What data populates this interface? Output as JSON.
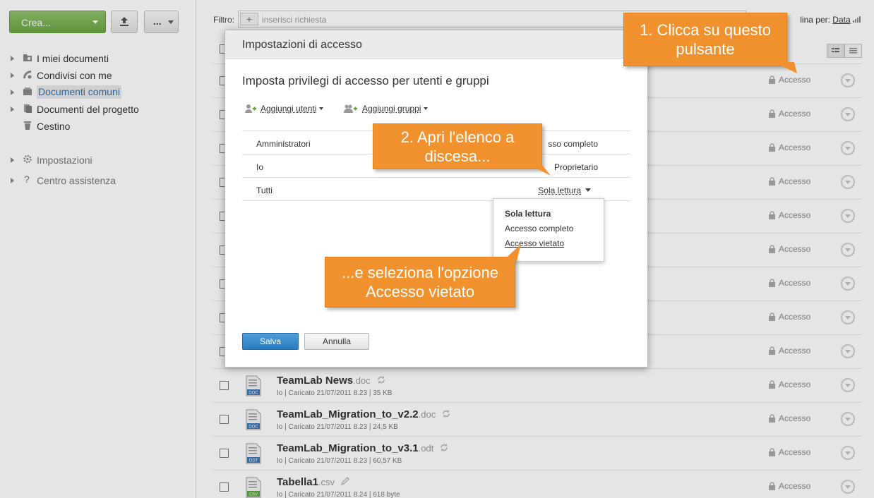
{
  "toolbar": {
    "create_label": "Crea...",
    "more_label": "..."
  },
  "sidebar": {
    "items": [
      {
        "label": "I miei documenti",
        "icon": "folder-user-icon"
      },
      {
        "label": "Condivisi con me",
        "icon": "shared-icon"
      },
      {
        "label": "Documenti comuni",
        "icon": "common-docs-icon"
      },
      {
        "label": "Documenti del progetto",
        "icon": "project-docs-icon"
      },
      {
        "label": "Cestino",
        "icon": "trash-icon"
      }
    ],
    "secondary": [
      {
        "label": "Impostazioni",
        "icon": "gear-icon"
      },
      {
        "label": "Centro assistenza",
        "icon": "help-icon"
      }
    ]
  },
  "filter": {
    "label": "Filtro:",
    "placeholder": "inserisci richiesta",
    "sort_prefix": "lina per:",
    "sort_value": "Data"
  },
  "file_rows": {
    "access_label": "Accesso",
    "files": [
      {
        "name": "TeamLab News",
        "ext": ".doc",
        "meta": "Io | Caricato 21/07/2011 8.23 | 35 KB",
        "type": "DOC"
      },
      {
        "name": "TeamLab_Migration_to_v2.2",
        "ext": ".doc",
        "meta": "Io | Caricato 21/07/2011 8.23 | 24,5 KB",
        "type": "DOC"
      },
      {
        "name": "TeamLab_Migration_to_v3.1",
        "ext": ".odt",
        "meta": "Io | Caricato 21/07/2011 8.23 | 60,57 KB",
        "type": "ODT"
      },
      {
        "name": "Tabella1",
        "ext": ".csv",
        "meta": "Io | Caricato 21/07/2011 8.24 | 618 byte",
        "type": "CSV"
      }
    ]
  },
  "dialog": {
    "title": "Impostazioni di accesso",
    "subtitle": "Imposta privilegi di accesso per utenti e gruppi",
    "add_users": "Aggiungi utenti",
    "add_groups": "Aggiungi gruppi",
    "rows": [
      {
        "name": "Amministratori",
        "right": "sso completo"
      },
      {
        "name": "Io",
        "right": "Proprietario"
      },
      {
        "name": "Tutti",
        "right": "Sola lettura"
      }
    ],
    "menu": {
      "selected": "Sola lettura",
      "option_full": "Accesso completo",
      "option_denied": "Accesso vietato"
    },
    "save": "Salva",
    "cancel": "Annulla"
  },
  "callouts": {
    "step1_line1": "1. Clicca su questo",
    "step1_line2": "pulsante",
    "step2_line1": "2. Apri l'elenco a",
    "step2_line2": "discesa...",
    "step3_line1": "...e seleziona l'opzione",
    "step3_line2": "Accesso vietato"
  },
  "colors": {
    "accent_orange": "#f2922e",
    "create_green": "#6aa744",
    "save_blue": "#2a7bbf",
    "active_link": "#3a6ea5"
  }
}
